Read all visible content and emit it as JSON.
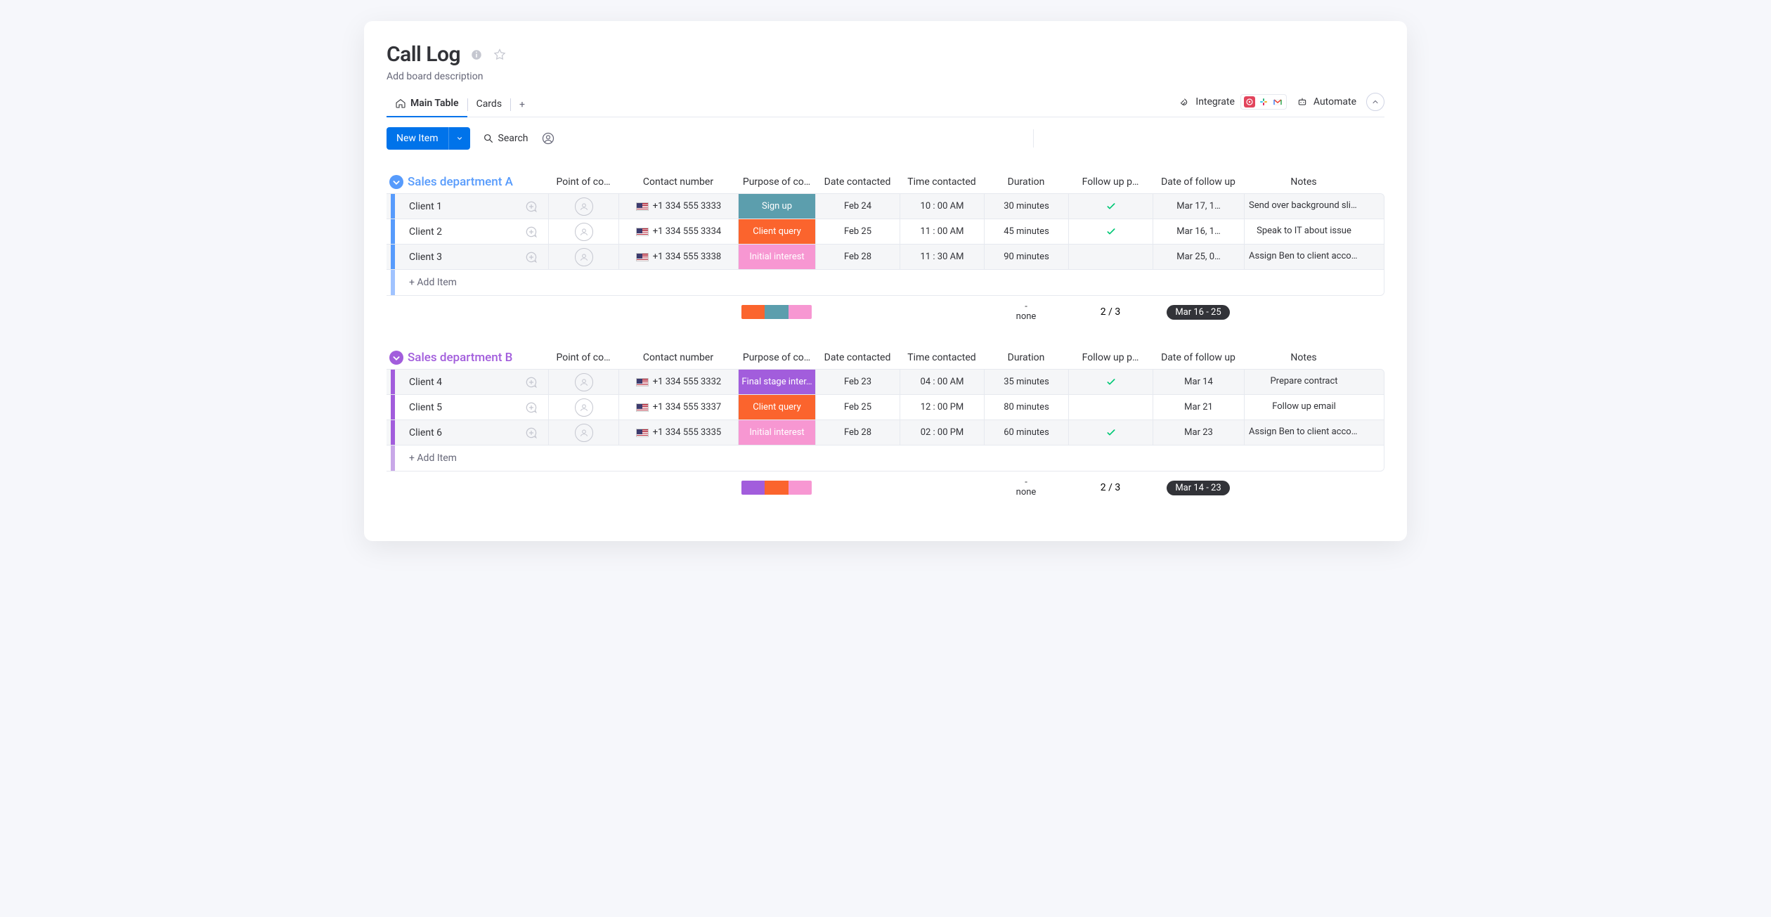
{
  "page_title": "Call Log",
  "board_description_placeholder": "Add board description",
  "tabs": {
    "main_table": "Main Table",
    "cards": "Cards"
  },
  "actions": {
    "integrate": "Integrate",
    "automate": "Automate"
  },
  "toolbar": {
    "new_item": "New Item",
    "search": "Search"
  },
  "columns": {
    "point_of_contact": "Point of co…",
    "contact_number": "Contact number",
    "purpose": "Purpose of co…",
    "date_contacted": "Date contacted",
    "time_contacted": "Time contacted",
    "duration": "Duration",
    "follow_up_planned": "Follow up p…",
    "date_follow_up": "Date of follow up",
    "notes": "Notes"
  },
  "add_item_label": "+ Add Item",
  "groups": [
    {
      "id": "a",
      "title": "Sales department A",
      "color": "#579bfc",
      "soft_color": "#a0c3ff",
      "rows": [
        {
          "name": "Client 1",
          "phone": "+1 334 555 3333",
          "purpose": {
            "label": "Sign up",
            "color": "#5c9ead"
          },
          "date_contacted": "Feb 24",
          "time_contacted": "10 : 00 AM",
          "duration": "30 minutes",
          "follow_up": true,
          "follow_up_date": "Mar 17, 1…",
          "notes": "Send over background slid…"
        },
        {
          "name": "Client 2",
          "phone": "+1 334 555 3334",
          "purpose": {
            "label": "Client query",
            "color": "#fb642d"
          },
          "date_contacted": "Feb 25",
          "time_contacted": "11 : 00 AM",
          "duration": "45 minutes",
          "follow_up": true,
          "follow_up_date": "Mar 16, 1…",
          "notes": "Speak to IT about issue"
        },
        {
          "name": "Client 3",
          "phone": "+1 334 555 3338",
          "purpose": {
            "label": "Initial interest",
            "color": "#f797d2"
          },
          "date_contacted": "Feb 28",
          "time_contacted": "11 : 30 AM",
          "duration": "90 minutes",
          "follow_up": false,
          "follow_up_date": "Mar 25, 0…",
          "notes": "Assign Ben to client accou…"
        }
      ],
      "summary": {
        "status_bars": [
          "#fb642d",
          "#5c9ead",
          "#f797d2"
        ],
        "duration_dash": "-",
        "duration_none": "none",
        "follow_up_fraction": "2 / 3",
        "date_range": "Mar 16 - 25"
      }
    },
    {
      "id": "b",
      "title": "Sales department B",
      "color": "#a25ddc",
      "soft_color": "#c9a8e8",
      "rows": [
        {
          "name": "Client 4",
          "phone": "+1 334 555 3332",
          "purpose": {
            "label": "Final stage inter…",
            "color": "#a25ddc"
          },
          "date_contacted": "Feb 23",
          "time_contacted": "04 : 00 AM",
          "duration": "35 minutes",
          "follow_up": true,
          "follow_up_date": "Mar 14",
          "notes": "Prepare contract"
        },
        {
          "name": "Client 5",
          "phone": "+1 334 555 3337",
          "purpose": {
            "label": "Client query",
            "color": "#fb642d"
          },
          "date_contacted": "Feb 25",
          "time_contacted": "12 : 00 PM",
          "duration": "80 minutes",
          "follow_up": false,
          "follow_up_date": "Mar 21",
          "notes": "Follow up email"
        },
        {
          "name": "Client 6",
          "phone": "+1 334 555 3335",
          "purpose": {
            "label": "Initial interest",
            "color": "#f797d2"
          },
          "date_contacted": "Feb 28",
          "time_contacted": "02 : 00 PM",
          "duration": "60 minutes",
          "follow_up": true,
          "follow_up_date": "Mar 23",
          "notes": "Assign Ben to client accou…"
        }
      ],
      "summary": {
        "status_bars": [
          "#a25ddc",
          "#fb642d",
          "#f797d2"
        ],
        "duration_dash": "-",
        "duration_none": "none",
        "follow_up_fraction": "2 / 3",
        "date_range": "Mar 14 - 23"
      }
    }
  ]
}
